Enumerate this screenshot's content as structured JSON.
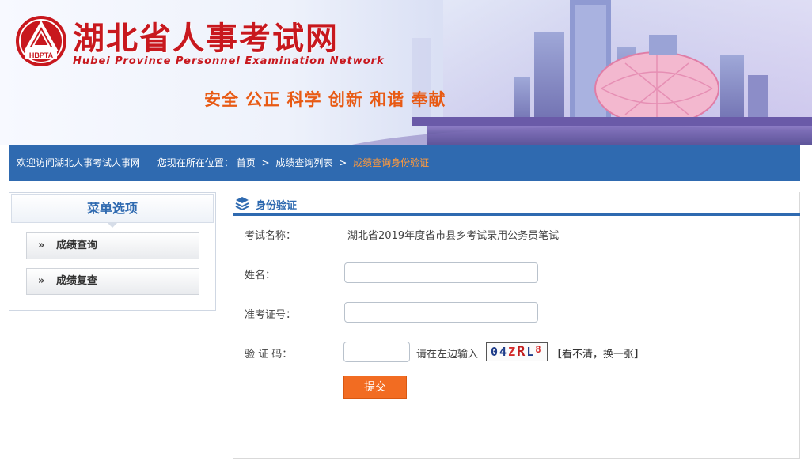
{
  "header": {
    "title": "湖北省人事考试网",
    "subtitle": "Hubei Province Personnel Examination Network",
    "logo_text": "HBPTA",
    "slogan": "安全 公正 科学 创新 和谐 奉献"
  },
  "navbar": {
    "welcome": "欢迎访问湖北人事考试人事网",
    "location_prefix": "您现在所在位置：",
    "crumbs": [
      "首页",
      "成绩查询列表",
      "成绩查询身份验证"
    ],
    "separator": ">"
  },
  "sidebar": {
    "title": "菜单选项",
    "items": [
      {
        "label": "成绩查询",
        "arrow": "»"
      },
      {
        "label": "成绩复查",
        "arrow": "»"
      }
    ]
  },
  "panel": {
    "title": "身份验证",
    "exam_label": "考试名称：",
    "exam_name": "湖北省2019年度省市县乡考试录用公务员笔试",
    "name_label": "姓名：",
    "name_value": "",
    "ticket_label": "准考证号：",
    "ticket_value": "",
    "captcha_label": "验 证 码：",
    "captcha_value": "",
    "captcha_hint": "请在左边输入",
    "captcha_chars": [
      "0",
      "4",
      "Z",
      "R",
      "L",
      "8"
    ],
    "refresh_text": "【看不清，换一张】",
    "submit_label": "提交"
  },
  "colors": {
    "brand_red": "#c8181e",
    "nav_blue": "#2f6ab0",
    "accent_orange": "#f26c22",
    "current_crumb": "#ff9a3c"
  }
}
